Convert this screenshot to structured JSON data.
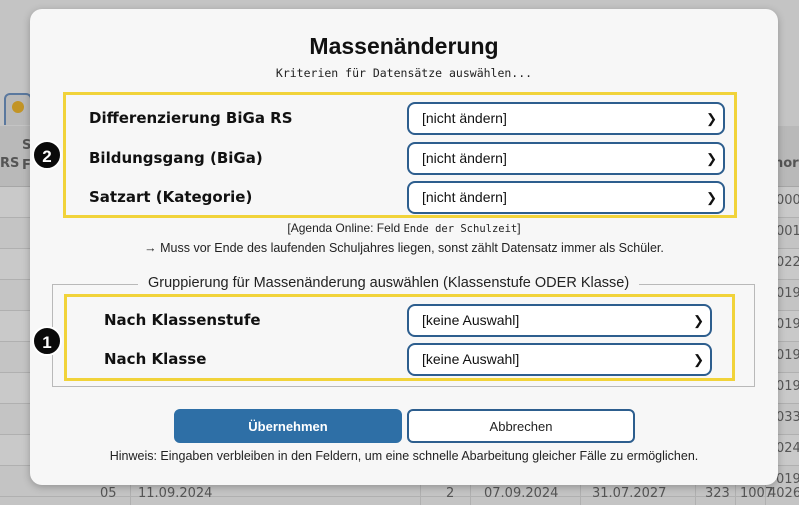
{
  "background": {
    "header_fragments": [
      "RS",
      "S",
      "F",
      "nort"
    ],
    "rows": [
      {
        "right": "000"
      },
      {
        "right": "001"
      },
      {
        "right": "022"
      },
      {
        "right": "019"
      },
      {
        "right": "019"
      },
      {
        "right": "019"
      },
      {
        "right": "019"
      },
      {
        "right": "033"
      },
      {
        "right": "024"
      },
      {
        "right": "019"
      }
    ],
    "last_row": [
      "05",
      "11.09.2024",
      "2",
      "07.09.2024",
      "31.07.2027",
      "323",
      "1007",
      "4026"
    ]
  },
  "modal": {
    "title": "Massenänderung",
    "subtitle": "Kriterien für Datensätze auswählen...",
    "section1_badge": "2",
    "section1_fields": [
      {
        "label": "Differenzierung BiGa RS",
        "value": "[nicht ändern]"
      },
      {
        "label": "Bildungsgang (BiGa)",
        "value": "[nicht ändern]"
      },
      {
        "label": "Satzart (Kategorie)",
        "value": "[nicht ändern]"
      }
    ],
    "note_prefix": "[Agenda Online: Feld ",
    "note_code": "Ende der Schulzeit",
    "note_suffix": "]",
    "note2": "→ Muss vor Ende des laufenden Schuljahres liegen, sonst zählt Datensatz immer als Schüler.",
    "group_legend": "Gruppierung für Massenänderung auswählen (Klassenstufe ODER Klasse)",
    "section2_badge": "1",
    "section2_fields": [
      {
        "label": "Nach Klassenstufe",
        "value": "[keine Auswahl]"
      },
      {
        "label": "Nach Klasse",
        "value": "[keine Auswahl]"
      }
    ],
    "apply_label": "Übernehmen",
    "cancel_label": "Abbrechen",
    "hint": "Hinweis: Eingaben verbleiben in den Feldern, um eine schnelle Abarbeitung gleicher Fälle zu ermöglichen."
  },
  "colors": {
    "highlight": "#f1d33a",
    "primary": "#2e6fa6",
    "select_border": "#2d5e8e"
  }
}
